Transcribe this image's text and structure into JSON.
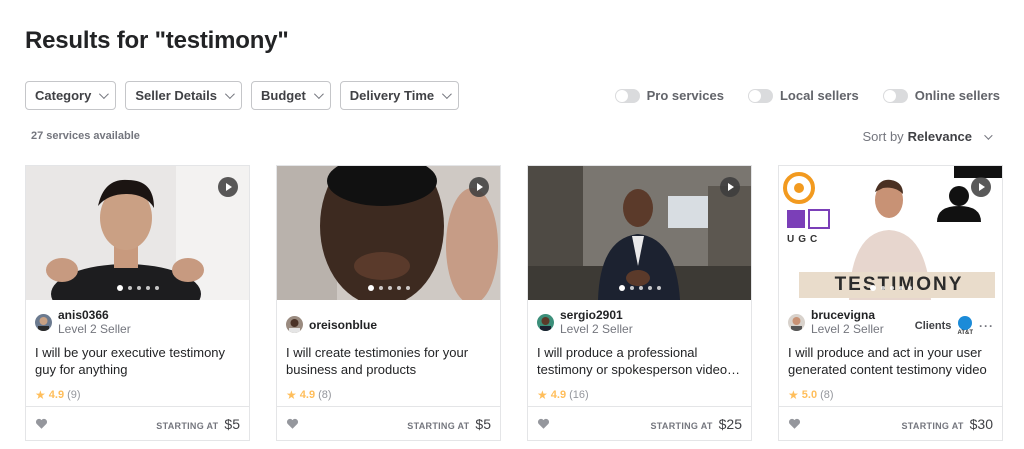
{
  "page": {
    "title": "Results for \"testimony\"",
    "services_count": "27 services available"
  },
  "filters": [
    {
      "label": "Category"
    },
    {
      "label": "Seller Details"
    },
    {
      "label": "Budget"
    },
    {
      "label": "Delivery Time"
    }
  ],
  "toggles": [
    {
      "label": "Pro services",
      "on": false
    },
    {
      "label": "Local sellers",
      "on": false
    },
    {
      "label": "Online sellers",
      "on": false
    }
  ],
  "sort": {
    "prefix": "Sort by",
    "value": "Relevance"
  },
  "cards": [
    {
      "seller": "anis0366",
      "level": "Level 2 Seller",
      "title": "I will be your executive testimony guy for anything",
      "rating": "4.9",
      "reviews": "(9)",
      "price_label": "STARTING AT",
      "price": "$5",
      "clients": ""
    },
    {
      "seller": "oreisonblue",
      "level": "",
      "title": "I will create testimonies for your business and products",
      "rating": "4.9",
      "reviews": "(8)",
      "price_label": "STARTING AT",
      "price": "$5",
      "clients": ""
    },
    {
      "seller": "sergio2901",
      "level": "Level 2 Seller",
      "title": "I will produce a professional testimony or spokesperson video for your business",
      "rating": "4.9",
      "reviews": "(16)",
      "price_label": "STARTING AT",
      "price": "$25",
      "clients": ""
    },
    {
      "seller": "brucevigna",
      "level": "Level 2 Seller",
      "title": "I will produce and act in your user generated content testimony video",
      "rating": "5.0",
      "reviews": "(8)",
      "price_label": "STARTING AT",
      "price": "$30",
      "clients": "Clients",
      "client_logo_text": "AT&T",
      "thumb_text_ugc": "UGC",
      "thumb_text_banner": "TESTIMONY"
    }
  ],
  "colors": {
    "star": "#ffbe5b",
    "border": "#e4e5e7",
    "text": "#222325",
    "muted": "#74767e"
  },
  "icons": [
    "play-icon",
    "chevron-down-icon",
    "star-icon",
    "heart-icon",
    "more-icon"
  ]
}
